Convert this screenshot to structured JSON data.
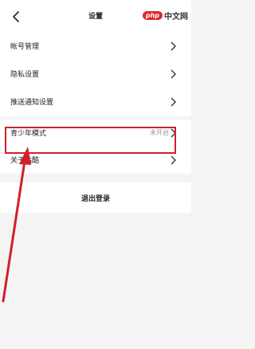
{
  "header": {
    "title": "设置"
  },
  "watermark": {
    "logo": "php",
    "text": "中文网"
  },
  "groups": [
    {
      "items": [
        {
          "label": "帐号管理"
        },
        {
          "label": "隐私设置"
        },
        {
          "label": "推送通知设置"
        }
      ]
    },
    {
      "items": [
        {
          "label": "青少年模式",
          "value": "未开启"
        },
        {
          "label": "关于站酷"
        }
      ]
    }
  ],
  "logout": {
    "label": "退出登录"
  },
  "annotation": {
    "color": "#d21f2c"
  }
}
